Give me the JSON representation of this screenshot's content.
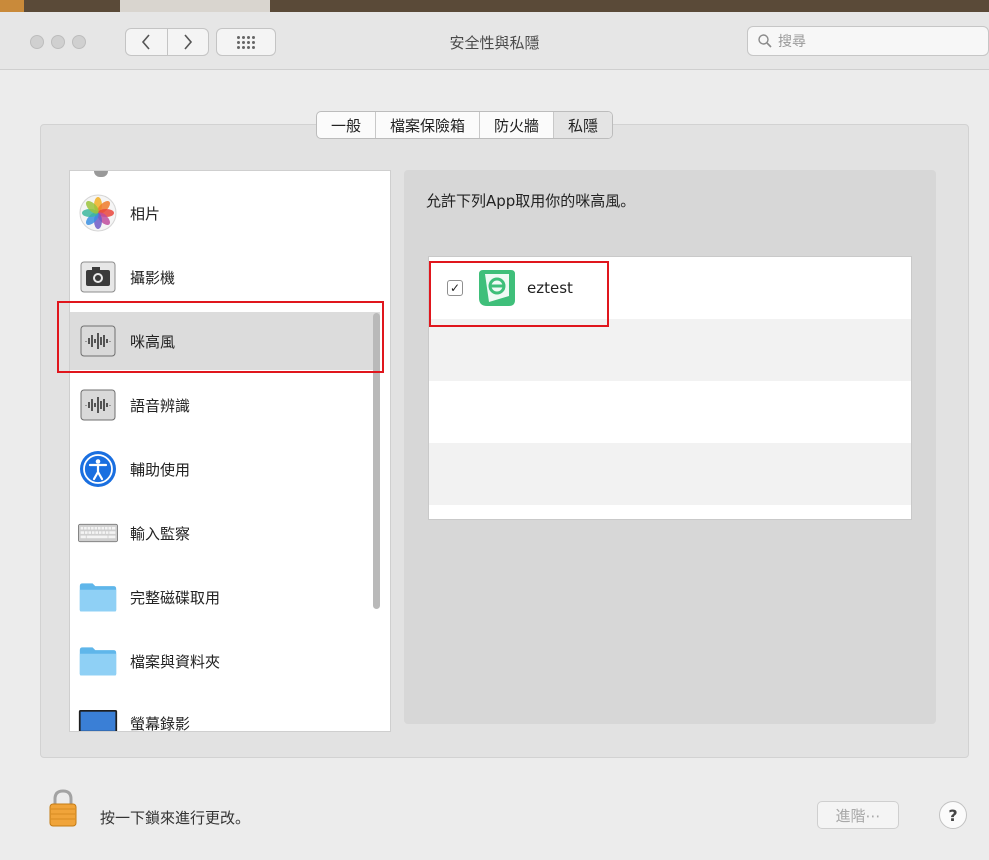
{
  "window": {
    "title": "安全性與私隱",
    "search_placeholder": "搜尋"
  },
  "tabs": [
    {
      "label": "一般",
      "active": false
    },
    {
      "label": "檔案保險箱",
      "active": false
    },
    {
      "label": "防火牆",
      "active": false
    },
    {
      "label": "私隱",
      "active": true
    }
  ],
  "sidebar": {
    "items": [
      {
        "label": "相片",
        "icon": "photos-icon"
      },
      {
        "label": "攝影機",
        "icon": "camera-icon"
      },
      {
        "label": "咪高風",
        "icon": "microphone-icon",
        "selected": true
      },
      {
        "label": "語音辨識",
        "icon": "speech-recognition-icon"
      },
      {
        "label": "輔助使用",
        "icon": "accessibility-icon"
      },
      {
        "label": "輸入監察",
        "icon": "keyboard-icon"
      },
      {
        "label": "完整磁碟取用",
        "icon": "folder-icon"
      },
      {
        "label": "檔案與資料夾",
        "icon": "folder-icon"
      },
      {
        "label": "螢幕錄影",
        "icon": "display-icon"
      }
    ]
  },
  "detail": {
    "heading": "允許下列App取用你的咪高風。",
    "apps": [
      {
        "name": "eztest",
        "checked": true,
        "check_glyph": "✓",
        "icon": "eztest-app-icon"
      }
    ]
  },
  "footer": {
    "lock_text": "按一下鎖來進行更改。",
    "advanced_label": "進階⋯",
    "help_label": "?"
  },
  "colors": {
    "highlight": "#e0161d",
    "app_icon_green": "#3fbf7a"
  }
}
